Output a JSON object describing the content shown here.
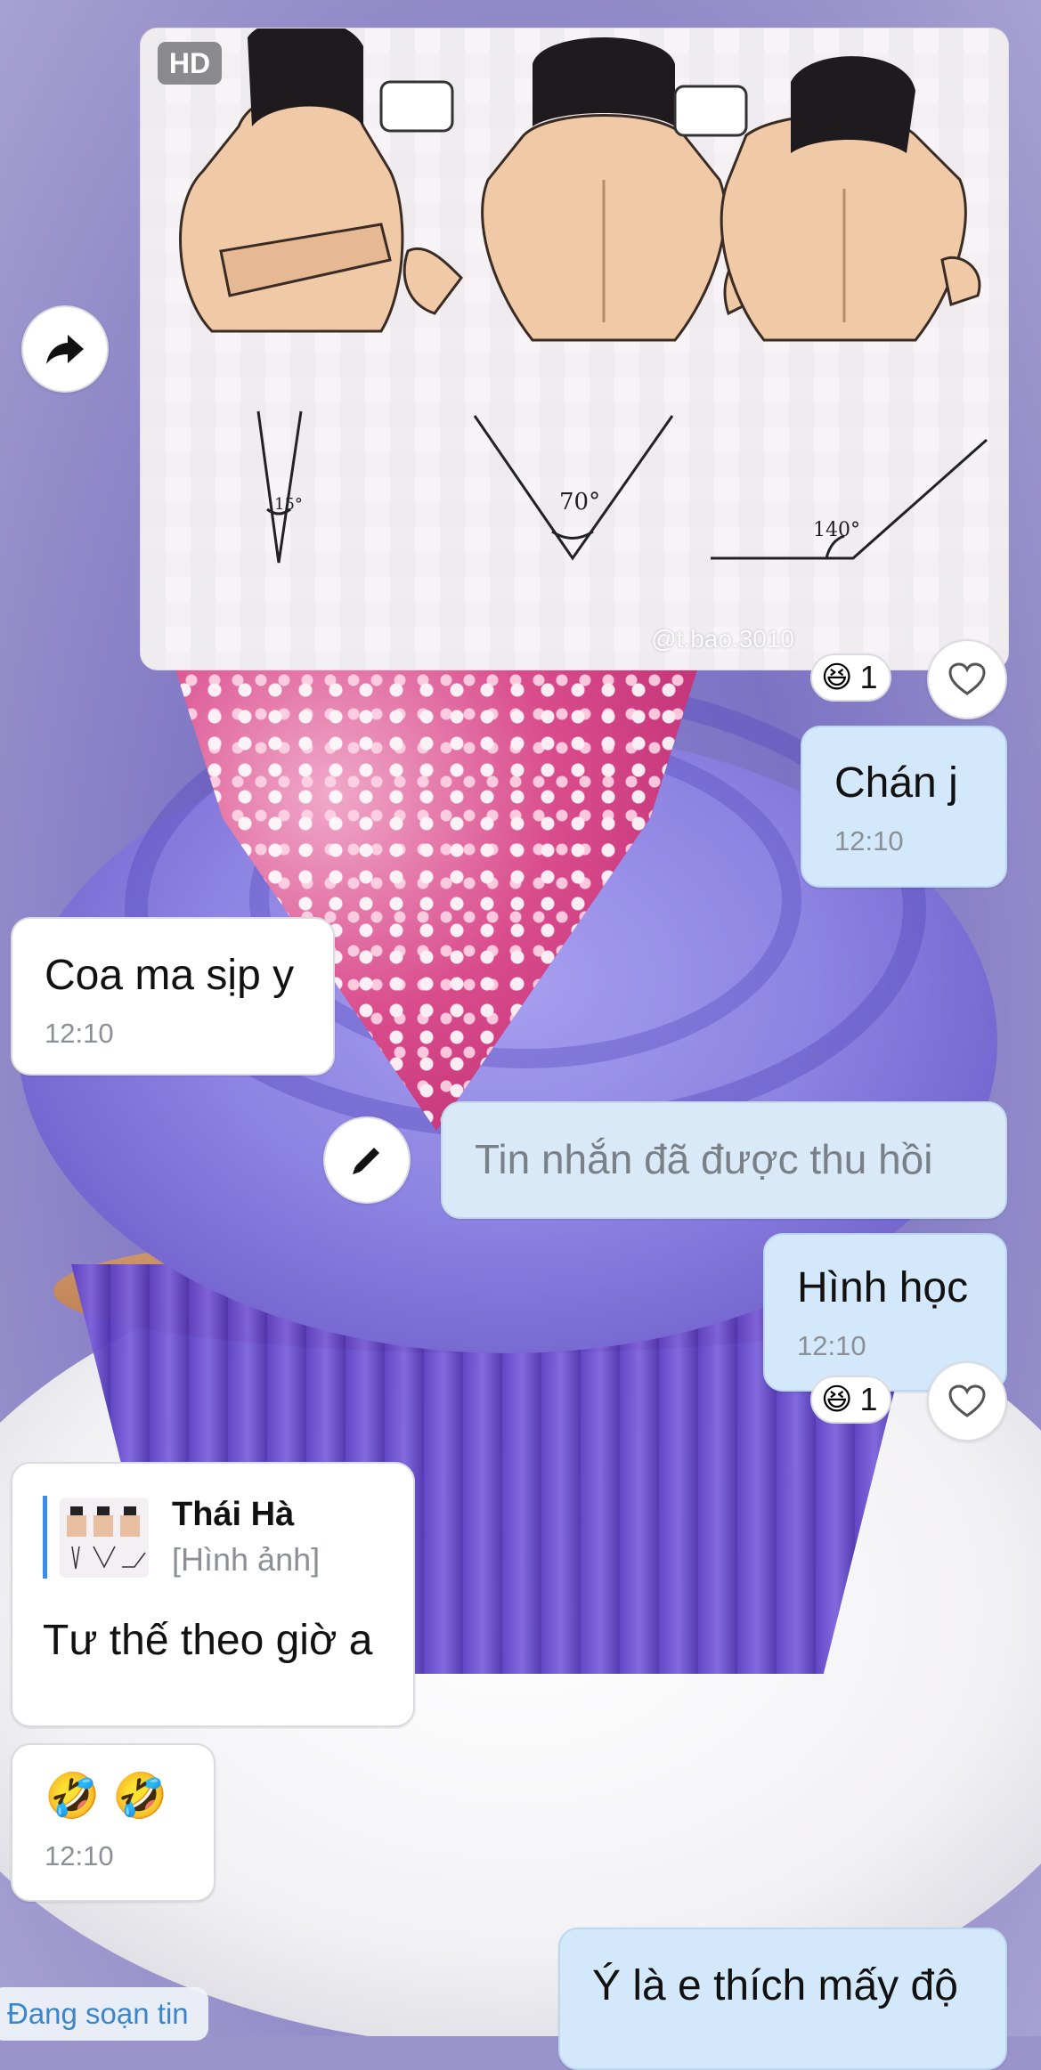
{
  "image_message": {
    "hd_badge": "HD",
    "watermark": "@t.bao.3010",
    "angle_labels": [
      "15°",
      "70°",
      "140°"
    ]
  },
  "reaction_icon": "laughing-face-emoji",
  "messages": {
    "m1": {
      "text": "Chán j",
      "time": "12:10"
    },
    "m2": {
      "text": "Coa ma sịp y",
      "time": "12:10"
    },
    "m3": {
      "text": "Tin nhắn đã được thu hồi"
    },
    "m4": {
      "text": "Hình học",
      "time": "12:10"
    },
    "m5": {
      "quote_name": "Thái Hà",
      "quote_sub": "[Hình ảnh]",
      "text": "Tư thế theo giờ a"
    },
    "m6": {
      "text": "🤣 🤣",
      "time": "12:10"
    },
    "m7": {
      "text": "Ý là e thích mấy độ"
    }
  },
  "reactions": {
    "image": {
      "emoji": "😆",
      "count": "1"
    },
    "m4": {
      "emoji": "😆",
      "count": "1"
    }
  },
  "typing_indicator": "Đang soạn tin",
  "icons": {
    "share": "share-forward-icon",
    "heart": "heart-outline-icon",
    "edit": "pencil-icon"
  },
  "colors": {
    "incoming_bubble": "#ffffff",
    "outgoing_bubble": "#d4e8fb",
    "quote_bar": "#3f8cf0",
    "typing_text": "#3b86c9"
  }
}
